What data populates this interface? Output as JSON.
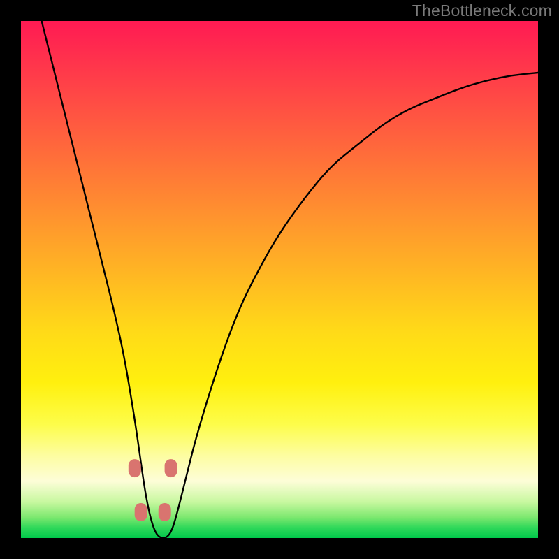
{
  "watermark": "TheBottleneck.com",
  "chart_data": {
    "type": "line",
    "title": "",
    "xlabel": "",
    "ylabel": "",
    "xlim": [
      0,
      100
    ],
    "ylim": [
      0,
      100
    ],
    "series": [
      {
        "name": "curve",
        "x": [
          4,
          6,
          8,
          10,
          12,
          14,
          16,
          18,
          20,
          22,
          23,
          24,
          25,
          26,
          27,
          28,
          29,
          30,
          32,
          34,
          38,
          42,
          46,
          50,
          55,
          60,
          65,
          70,
          75,
          80,
          85,
          90,
          95,
          100
        ],
        "values": [
          100,
          92,
          84,
          76,
          68,
          60,
          52,
          44,
          35,
          23,
          16,
          9,
          4,
          1,
          0,
          0,
          1,
          4,
          12,
          20,
          33,
          44,
          52,
          59,
          66,
          72,
          76,
          80,
          83,
          85,
          87,
          88.5,
          89.5,
          90
        ]
      }
    ],
    "markers": [
      {
        "x": 22.0,
        "y": 13.5
      },
      {
        "x": 23.2,
        "y": 5.0
      },
      {
        "x": 27.8,
        "y": 5.0
      },
      {
        "x": 29.0,
        "y": 13.5
      }
    ],
    "colors": {
      "curve_stroke": "#000000",
      "marker_fill": "#d9746f",
      "gradient_top": "#ff1a53",
      "gradient_bottom": "#00c84b"
    }
  }
}
